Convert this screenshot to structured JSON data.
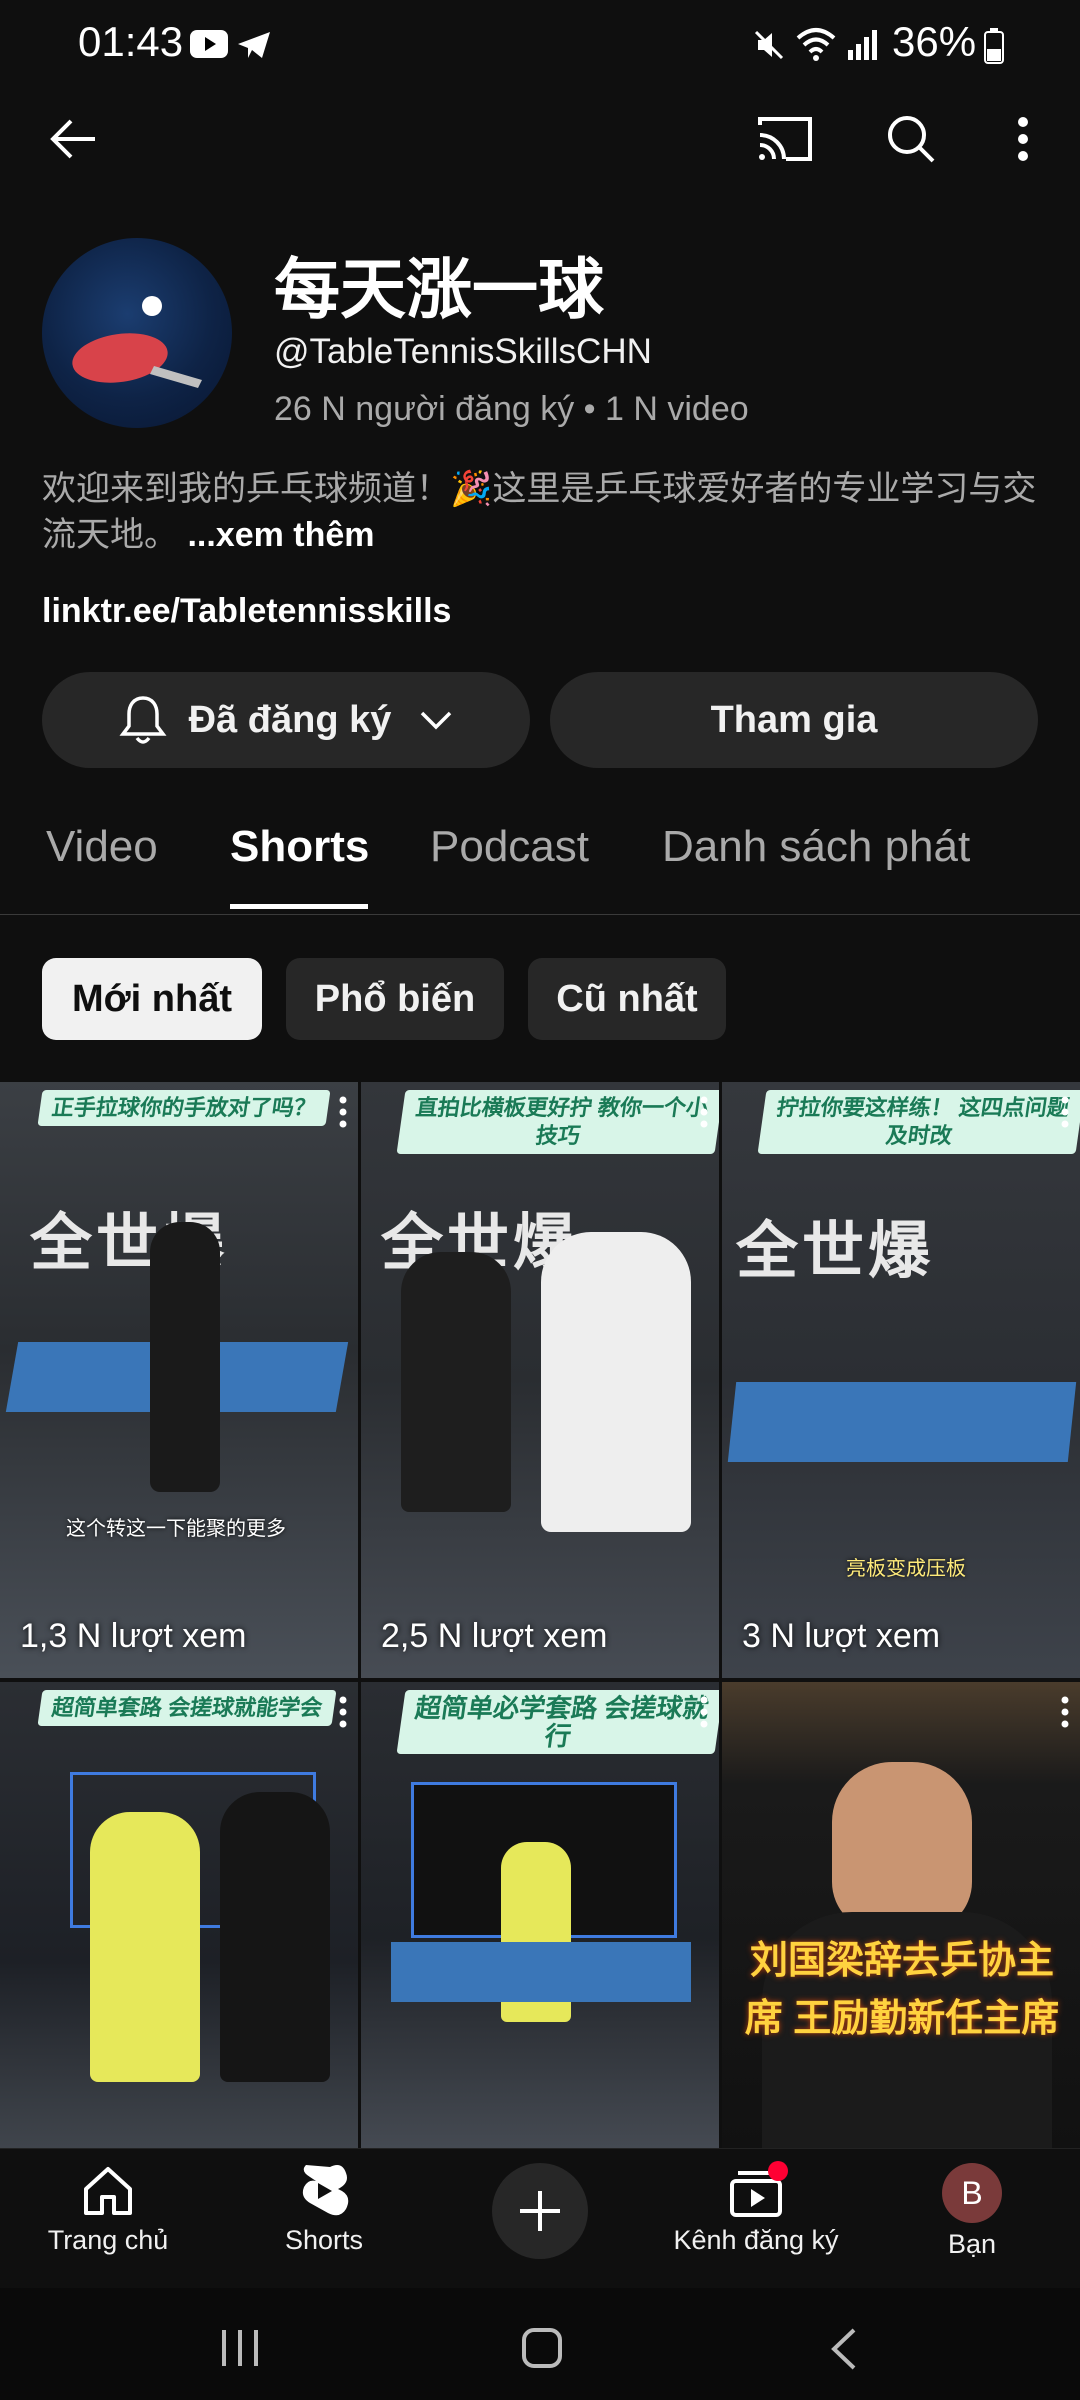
{
  "status_bar": {
    "time": "01:43",
    "battery": "36%"
  },
  "header": {
    "back_icon": "arrow-left-icon",
    "cast_icon": "cast-icon",
    "search_icon": "search-icon",
    "more_icon": "kebab-vertical-icon"
  },
  "channel": {
    "name": "每天涨一球",
    "handle": "@TableTennisSkillsCHN",
    "meta": "26 N người đăng ký • 1 N video",
    "description": "欢迎来到我的乒乓球频道！🎉这里是乒乓球爱好者的专业学习与交流天地。",
    "more_label": "...xem thêm",
    "link": "linktr.ee/Tabletennisskills"
  },
  "actions": {
    "subscribed_label": "Đã đăng ký",
    "join_label": "Tham gia"
  },
  "tabs": [
    {
      "label": "Video"
    },
    {
      "label": "Shorts"
    },
    {
      "label": "Podcast"
    },
    {
      "label": "Danh sách phát"
    }
  ],
  "chips": [
    {
      "label": "Mới nhất"
    },
    {
      "label": "Phổ biến"
    },
    {
      "label": "Cũ nhất"
    }
  ],
  "shorts": [
    {
      "views": "1,3 N lượt xem",
      "banner": "正手拉球你的手放对了吗？",
      "caption": "这个转这一下能聚的更多"
    },
    {
      "views": "2,5 N lượt xem",
      "banner": "直拍比横板更好拧 教你一个小技巧",
      "caption": ""
    },
    {
      "views": "3 N lượt xem",
      "banner": "拧拉你要这样练！ 这四点问题及时改",
      "caption": "亮板变成压板"
    },
    {
      "views": "",
      "banner": "超简单套路 会搓球就能学会",
      "caption": ""
    },
    {
      "views": "",
      "banner": "超简单必学套路 会搓球就行",
      "caption": ""
    },
    {
      "views": "",
      "banner": "",
      "caption": "刘国梁辞去乒协主席 王励勤新任主席"
    }
  ],
  "bottom_nav": [
    {
      "label": "Trang chủ",
      "icon": "home-icon"
    },
    {
      "label": "Shorts",
      "icon": "shorts-icon"
    },
    {
      "label": "",
      "icon": "plus-icon"
    },
    {
      "label": "Kênh đăng ký",
      "icon": "subscriptions-icon"
    },
    {
      "label": "Bạn",
      "avatar_letter": "B"
    }
  ],
  "colors": {
    "background": "#0f0f0f",
    "notification": "#ff0033",
    "avatar_bg": "#7a3a3a"
  }
}
